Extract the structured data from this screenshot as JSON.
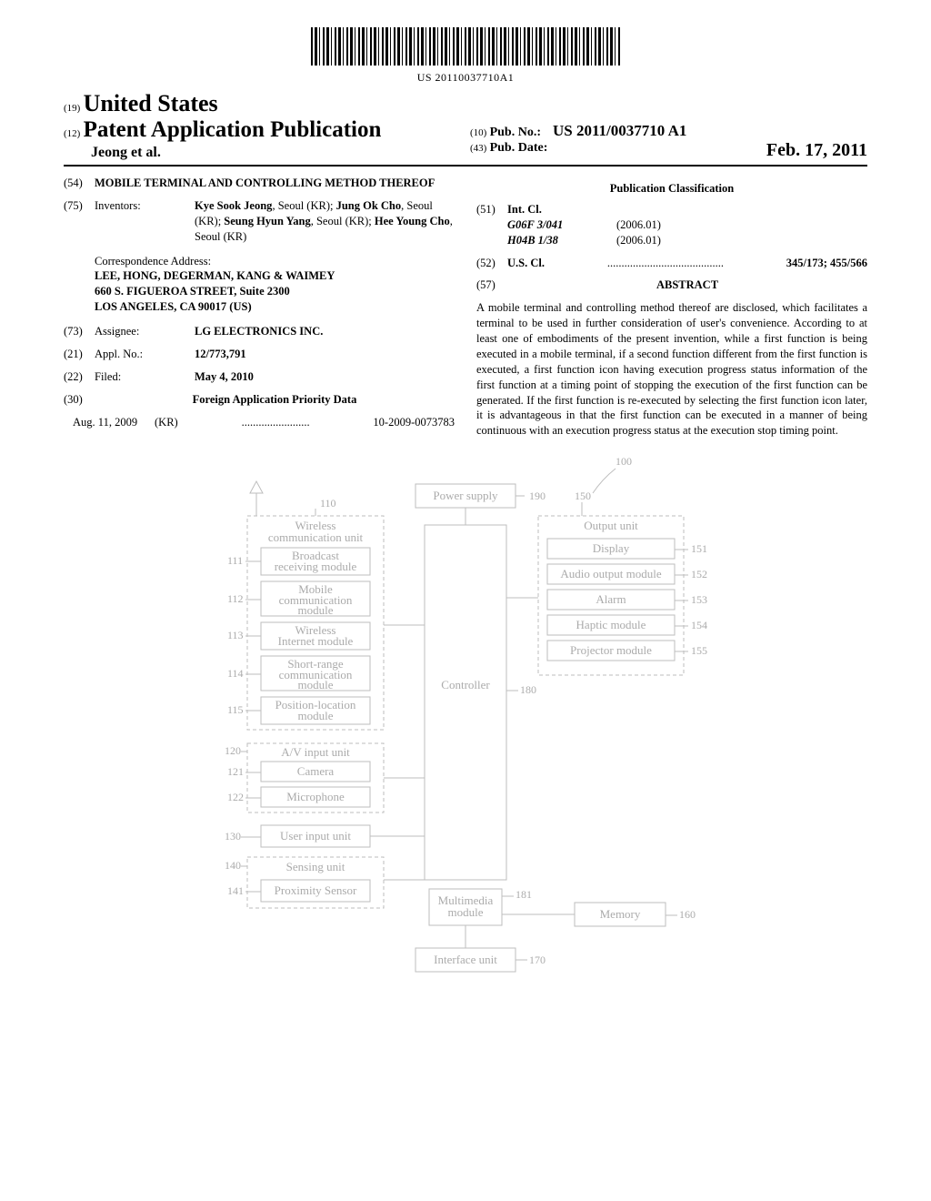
{
  "barcode_label": "US 20110037710A1",
  "header": {
    "country_tag": "(19)",
    "country": "United States",
    "pub_tag": "(12)",
    "pub_title": "Patent Application Publication",
    "inventor_line": "Jeong et al.",
    "pub_no_tag": "(10)",
    "pub_no_label": "Pub. No.:",
    "pub_no_value": "US 2011/0037710 A1",
    "pub_date_tag": "(43)",
    "pub_date_label": "Pub. Date:",
    "pub_date_value": "Feb. 17, 2011"
  },
  "biblio": {
    "title_tag": "(54)",
    "title": "MOBILE TERMINAL AND CONTROLLING METHOD THEREOF",
    "inventors_tag": "(75)",
    "inventors_label": "Inventors:",
    "inventors_value": "Kye Sook Jeong, Seoul (KR); Jung Ok Cho, Seoul (KR); Seung Hyun Yang, Seoul (KR); Hee Young Cho, Seoul (KR)",
    "corr_heading": "Correspondence Address:",
    "corr_name": "LEE, HONG, DEGERMAN, KANG & WAIMEY",
    "corr_street": "660 S. FIGUEROA STREET, Suite 2300",
    "corr_city": "LOS ANGELES, CA 90017 (US)",
    "assignee_tag": "(73)",
    "assignee_label": "Assignee:",
    "assignee_value": "LG ELECTRONICS INC.",
    "appl_tag": "(21)",
    "appl_label": "Appl. No.:",
    "appl_value": "12/773,791",
    "filed_tag": "(22)",
    "filed_label": "Filed:",
    "filed_value": "May 4, 2010",
    "foreign_tag": "(30)",
    "foreign_heading": "Foreign Application Priority Data",
    "foreign_date": "Aug. 11, 2009",
    "foreign_country": "(KR)",
    "foreign_dots": "........................",
    "foreign_number": "10-2009-0073783",
    "class_heading": "Publication Classification",
    "intcl_tag": "(51)",
    "intcl_label": "Int. Cl.",
    "intcl_rows": [
      {
        "code": "G06F 3/041",
        "year": "(2006.01)"
      },
      {
        "code": "H04B 1/38",
        "year": "(2006.01)"
      }
    ],
    "uscl_tag": "(52)",
    "uscl_label": "U.S. Cl.",
    "uscl_dots": ".........................................",
    "uscl_value": "345/173; 455/566",
    "abstract_tag": "(57)",
    "abstract_label": "ABSTRACT",
    "abstract_text": "A mobile terminal and controlling method thereof are disclosed, which facilitates a terminal to be used in further consideration of user's convenience. According to at least one of embodiments of the present invention, while a first function is being executed in a mobile terminal, if a second function different from the first function is executed, a first function icon having execution progress status information of the first function at a timing point of stopping the execution of the first function can be generated. If the first function is re-executed by selecting the first function icon later, it is advantageous in that the first function can be executed in a manner of being continuous with an execution progress status at the execution stop timing point."
  },
  "figure": {
    "device_ref": "100",
    "wireless_unit": {
      "ref": "110",
      "label": "Wireless communication unit"
    },
    "broadcast": {
      "ref": "111",
      "label": "Broadcast receiving module"
    },
    "mobile_comm": {
      "ref": "112",
      "label": "Mobile communication module"
    },
    "wireless_internet": {
      "ref": "113",
      "label": "Wireless Internet module"
    },
    "short_range": {
      "ref": "114",
      "label": "Short-range communication module"
    },
    "position": {
      "ref": "115",
      "label": "Position-location module"
    },
    "av_input": {
      "ref": "120",
      "label": "A/V input unit"
    },
    "camera": {
      "ref": "121",
      "label": "Camera"
    },
    "microphone": {
      "ref": "122",
      "label": "Microphone"
    },
    "user_input": {
      "ref": "130",
      "label": "User input unit"
    },
    "sensing": {
      "ref": "140",
      "label": "Sensing unit"
    },
    "proximity": {
      "ref": "141",
      "label": "Proximity Sensor"
    },
    "power": {
      "ref": "190",
      "label": "Power supply"
    },
    "controller": {
      "ref": "180",
      "label": "Controller"
    },
    "multimedia": {
      "ref": "181",
      "label": "Multimedia module"
    },
    "output_unit": {
      "ref": "150",
      "label": "Output unit"
    },
    "display": {
      "ref": "151",
      "label": "Display"
    },
    "audio_out": {
      "ref": "152",
      "label": "Audio output module"
    },
    "alarm": {
      "ref": "153",
      "label": "Alarm"
    },
    "haptic": {
      "ref": "154",
      "label": "Haptic module"
    },
    "projector": {
      "ref": "155",
      "label": "Projector module"
    },
    "memory": {
      "ref": "160",
      "label": "Memory"
    },
    "interface": {
      "ref": "170",
      "label": "Interface unit"
    }
  }
}
